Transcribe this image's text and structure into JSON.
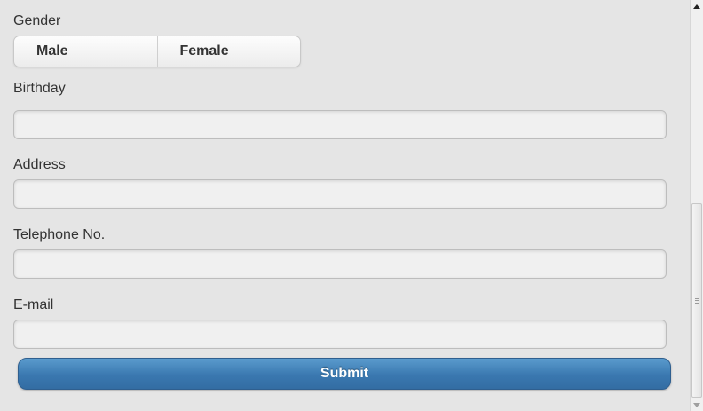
{
  "form": {
    "gender": {
      "label": "Gender",
      "options": [
        "Male",
        "Female"
      ]
    },
    "birthday": {
      "label": "Birthday",
      "value": "",
      "placeholder": ""
    },
    "address": {
      "label": "Address",
      "value": "",
      "placeholder": ""
    },
    "telephone": {
      "label": "Telephone No.",
      "value": "",
      "placeholder": ""
    },
    "email": {
      "label": "E-mail",
      "value": "",
      "placeholder": ""
    },
    "submit_label": "Submit"
  },
  "colors": {
    "page_background": "#e5e5e5",
    "submit_button": "#3a78b0",
    "input_background": "#f0f0f0"
  },
  "scrollbar": {
    "position_fraction": 0.5
  }
}
